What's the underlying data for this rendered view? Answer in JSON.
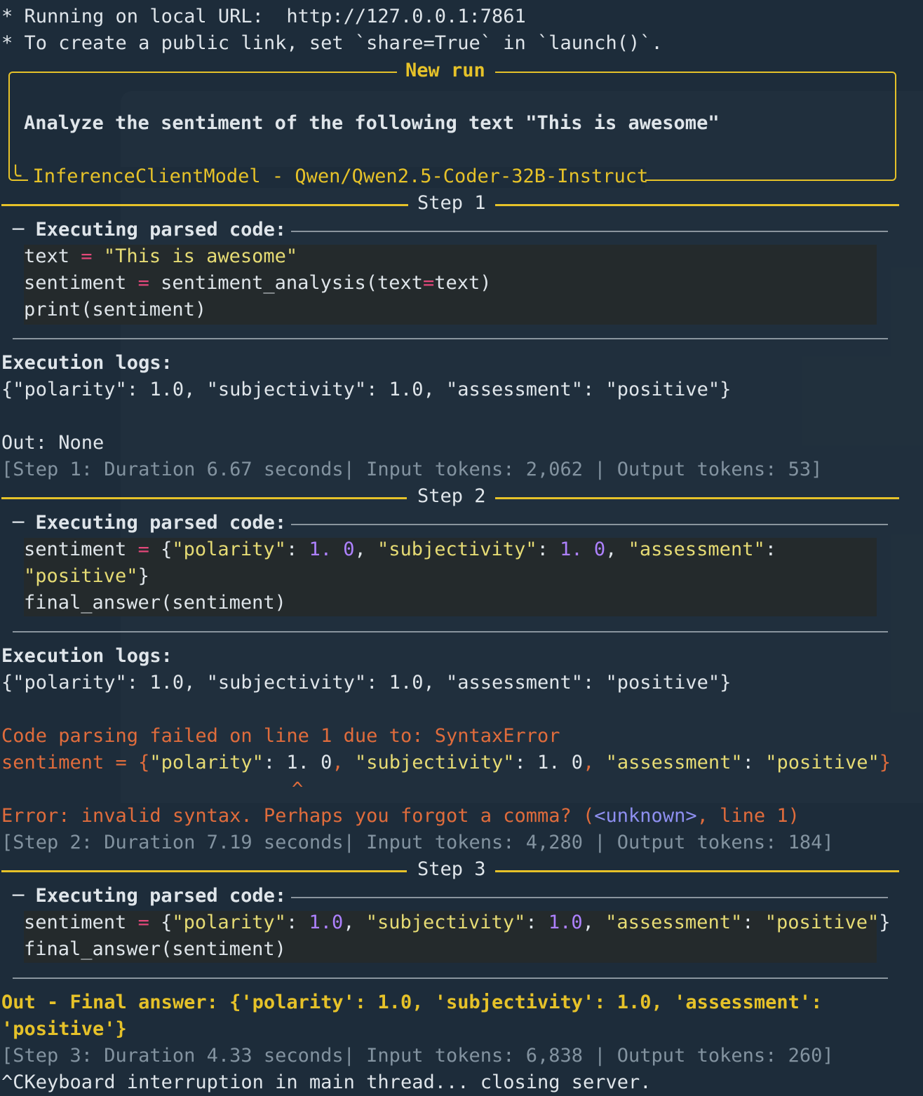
{
  "header": {
    "line1": "* Running on local URL:  http://127.0.0.1:7861",
    "line2": "* To create a public link, set `share=True` in `launch()`."
  },
  "new_run": {
    "title": "New run",
    "task": "Analyze the sentiment of the following text \"This is awesome\"",
    "model": "InferenceClientModel - Qwen/Qwen2.5-Coder-32B-Instruct"
  },
  "steps": [
    {
      "title": "Step 1",
      "exec_label": "Executing parsed code:",
      "code": {
        "l1_var": "text",
        "l1_op": "=",
        "l1_str": "\"This is awesome\"",
        "l2_var": "sentiment",
        "l2_op": "=",
        "l2_call": "sentiment_analysis(text",
        "l2_eq": "=",
        "l2_end": "text)",
        "l3": "print(sentiment)"
      },
      "logs_label": "Execution logs:",
      "logs": "{\"polarity\": 1.0, \"subjectivity\": 1.0, \"assessment\": \"positive\"}",
      "out": "Out: None",
      "stats": "[Step 1: Duration 6.67 seconds| Input tokens: 2,062 | Output tokens: 53]"
    },
    {
      "title": "Step 2",
      "exec_label": "Executing parsed code:",
      "code": {
        "var": "sentiment",
        "op": "=",
        "brace": "{",
        "k1": "\"polarity\"",
        "v1": "1. 0",
        "k2": "\"subjectivity\"",
        "v2": "1. 0",
        "k3": "\"assessment\"",
        "v3": "\"positive\"",
        "close": "}",
        "l3": "final_answer(sentiment)"
      },
      "logs_label": "Execution logs:",
      "logs": "{\"polarity\": 1.0, \"subjectivity\": 1.0, \"assessment\": \"positive\"}",
      "error_title": "Code parsing failed on line 1 due to: SyntaxError",
      "error_code": {
        "pre": "sentiment = {",
        "k1": "\"polarity\"",
        "v1": ": 1. 0",
        "comma1": ", ",
        "k2": "\"subjectivity\"",
        "v2": ": 1. 0",
        "comma2": ", ",
        "k3": "\"assessment\"",
        "v3": ": ",
        "s3": "\"positive\"",
        "close": "}"
      },
      "caret": "^",
      "error_msg_pre": "Error: invalid syntax. Perhaps you forgot a comma? (",
      "error_msg_unknown": "<unknown>",
      "error_msg_post": ", line 1)",
      "stats": "[Step 2: Duration 7.19 seconds| Input tokens: 4,280 | Output tokens: 184]"
    },
    {
      "title": "Step 3",
      "exec_label": "Executing parsed code:",
      "code": {
        "var": "sentiment",
        "op": "=",
        "brace": "{",
        "k1": "\"polarity\"",
        "v1": "1.0",
        "k2": "\"subjectivity\"",
        "v2": "1.0",
        "k3": "\"assessment\"",
        "v3": "\"positive\"",
        "close": "}",
        "l2": "final_answer(sentiment)"
      },
      "final_line1": "Out - Final answer: {'polarity': 1.0, 'subjectivity': 1.0, 'assessment':",
      "final_line2": "'positive'}",
      "stats": "[Step 3: Duration 4.33 seconds| Input tokens: 6,838 | Output tokens: 260]"
    }
  ],
  "footer": "^CKeyboard interruption in main thread... closing server.",
  "colors": {
    "background": "#1d2c3a",
    "accent_yellow": "#e6c229",
    "error_red": "#e06c3c"
  }
}
